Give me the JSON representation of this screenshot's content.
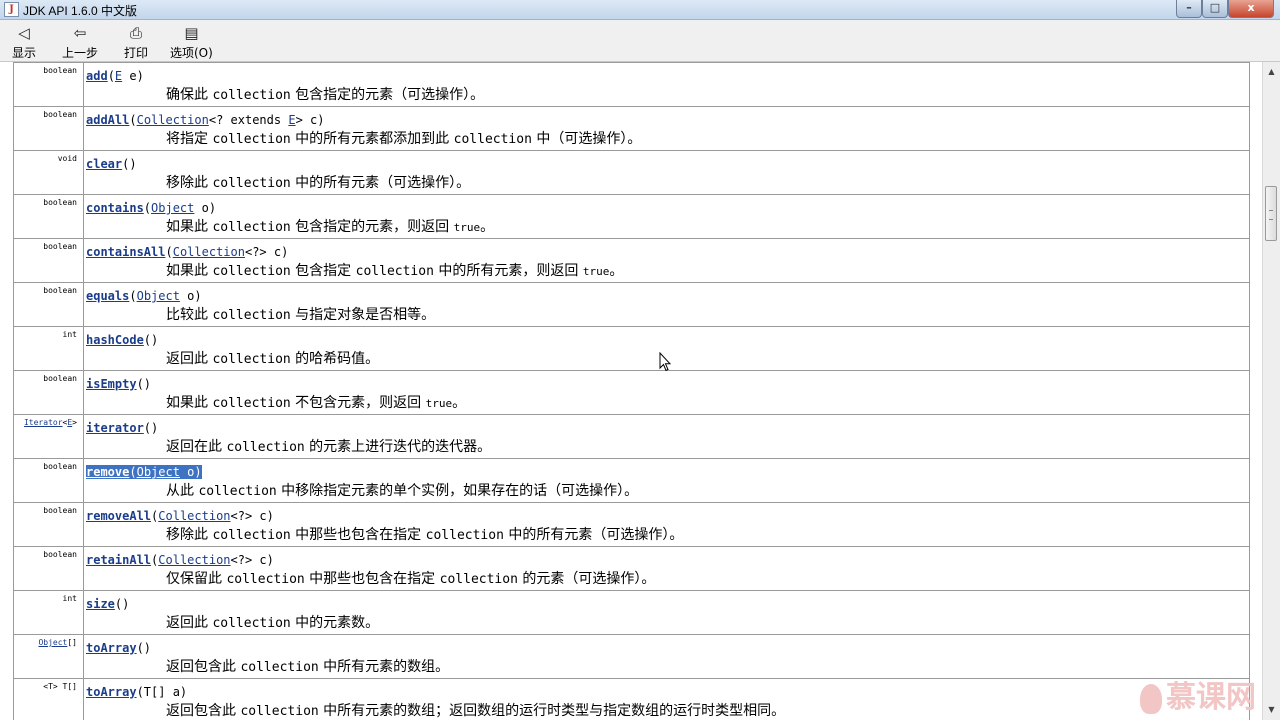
{
  "window": {
    "title": "JDK API 1.6.0 中文版",
    "controls": {
      "min": "–",
      "max": "□",
      "close": "x"
    }
  },
  "toolbar": [
    {
      "label": "显示",
      "icon": "show-icon",
      "glyph": "◁"
    },
    {
      "label": "上一步",
      "icon": "back-arrow-icon",
      "glyph": "⇦"
    },
    {
      "label": "打印",
      "icon": "printer-icon",
      "glyph": "⎙"
    },
    {
      "label": "选项(O)",
      "icon": "options-icon",
      "glyph": "▤"
    }
  ],
  "methods": [
    {
      "type": "boolean",
      "name": "add",
      "params_html": "(<span class='link'>E</span> e)",
      "desc_html": "确保此 <span class='code'>collection</span> 包含指定的元素（可选操作）。"
    },
    {
      "type": "boolean",
      "name": "addAll",
      "params_html": "(<span class='link'>Collection</span>&lt;? extends <span class='link'>E</span>&gt; c)",
      "desc_html": "将指定 <span class='code'>collection</span> 中的所有元素都添加到此 <span class='code'>collection</span> 中（可选操作）。"
    },
    {
      "type": "void",
      "name": "clear",
      "params_html": "()",
      "desc_html": "移除此 <span class='code'>collection</span> 中的所有元素（可选操作）。"
    },
    {
      "type": "boolean",
      "name": "contains",
      "params_html": "(<span class='link'>Object</span> o)",
      "desc_html": "如果此 <span class='code'>collection</span> 包含指定的元素，则返回 <span class='small'>true</span>。"
    },
    {
      "type": "boolean",
      "name": "containsAll",
      "params_html": "(<span class='link'>Collection</span>&lt;?&gt; c)",
      "desc_html": "如果此 <span class='code'>collection</span> 包含指定 <span class='code'>collection</span> 中的所有元素，则返回 <span class='small'>true</span>。"
    },
    {
      "type": "boolean",
      "name": "equals",
      "params_html": "(<span class='link'>Object</span> o)",
      "desc_html": "比较此 <span class='code'>collection</span> 与指定对象是否相等。"
    },
    {
      "type": "int",
      "name": "hashCode",
      "params_html": "()",
      "desc_html": "返回此 <span class='code'>collection</span> 的哈希码值。"
    },
    {
      "type": "boolean",
      "name": "isEmpty",
      "params_html": "()",
      "desc_html": "如果此 <span class='code'>collection</span> 不包含元素，则返回 <span class='small'>true</span>。"
    },
    {
      "type_html": "<span class='link'>Iterator</span>&lt;<span class='link'>E</span>&gt;",
      "type": "Iterator<E>",
      "name": "iterator",
      "params_html": "()",
      "desc_html": "返回在此 <span class='code'>collection</span> 的元素上进行迭代的迭代器。"
    },
    {
      "type": "boolean",
      "name": "remove",
      "highlight": true,
      "params_html": "(<span class='link'>Object</span> o)",
      "desc_html": "从此 <span class='code'>collection</span> 中移除指定元素的单个实例，如果存在的话（可选操作）。"
    },
    {
      "type": "boolean",
      "name": "removeAll",
      "params_html": "(<span class='link'>Collection</span>&lt;?&gt; c)",
      "desc_html": "移除此 <span class='code'>collection</span> 中那些也包含在指定 <span class='code'>collection</span> 中的所有元素（可选操作）。"
    },
    {
      "type": "boolean",
      "name": "retainAll",
      "params_html": "(<span class='link'>Collection</span>&lt;?&gt; c)",
      "desc_html": "仅保留此 <span class='code'>collection</span> 中那些也包含在指定 <span class='code'>collection</span> 的元素（可选操作）。"
    },
    {
      "type": "int",
      "name": "size",
      "params_html": "()",
      "desc_html": "返回此 <span class='code'>collection</span> 中的元素数。"
    },
    {
      "type_html": "<span class='link'>Object</span>[]",
      "type": "Object[]",
      "name": "toArray",
      "params_html": "()",
      "desc_html": "返回包含此 <span class='code'>collection</span> 中所有元素的数组。"
    },
    {
      "type": "<T> T[]",
      "name": "toArray",
      "params_html": "(T[] a)",
      "desc_html": "返回包含此 <span class='code'>collection</span> 中所有元素的数组；返回数组的运行时类型与指定数组的运行时类型相同。"
    }
  ],
  "watermark": "慕课网",
  "colors": {
    "link": "#1a3c8a",
    "highlight": "#3e73c4",
    "border": "#9a9a9a"
  }
}
